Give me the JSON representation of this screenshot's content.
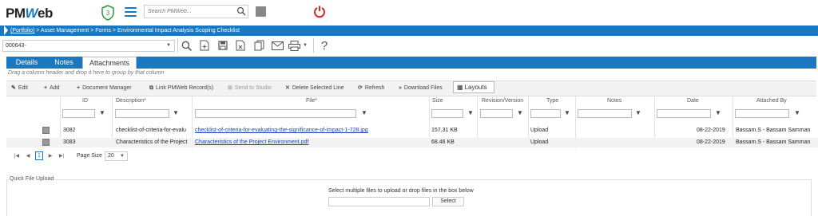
{
  "app": {
    "logo_text": "PMWeb",
    "badge_count": "3",
    "search": {
      "placeholder": "Search PMWeb..."
    }
  },
  "breadcrumb": {
    "root": "(Portfolio)",
    "path": " > Asset Management > Forms > Environmental Impact Analysis Scoping Checklist"
  },
  "record": {
    "selected": "000643-"
  },
  "tabs": [
    {
      "label": "Details"
    },
    {
      "label": "Notes"
    },
    {
      "label": "Attachments",
      "active": true
    }
  ],
  "group_hint": "Drag a column header and drop it here to group by that column",
  "actions": {
    "edit": "Edit",
    "add": "Add",
    "document_manager": "Document Manager",
    "link_records": "Link PMWeb Record(s)",
    "send_to_studio": "Send to Studio",
    "delete_line": "Delete Selected Line",
    "refresh": "Refresh",
    "download": "Download Files",
    "layouts": "Layouts"
  },
  "grid": {
    "columns": [
      "ID",
      "Description*",
      "File*",
      "Size",
      "Revision/Version",
      "Type",
      "Notes",
      "Date",
      "Attached By"
    ],
    "rows": [
      {
        "id": "3082",
        "description": "checklist-of-criteria-for-evalu",
        "file": "checklist-of-criteria-for-evaluating-the-significance-of-impact-1-728.jpg",
        "size": "157.31 KB",
        "revision": "",
        "type": "Upload",
        "notes": "",
        "date": "08-22-2019",
        "attached_by": "Bassam.S - Bassam Samman"
      },
      {
        "id": "3083",
        "description": "Characteristics of the Project",
        "file": "Characteristics of the Project Environment.pdf",
        "size": "68.46 KB",
        "revision": "",
        "type": "Upload",
        "notes": "",
        "date": "08-22-2019",
        "attached_by": "Bassam.S - Bassam Samman"
      }
    ]
  },
  "pager": {
    "current_page": "1",
    "page_size_label": "Page Size",
    "page_size": "20"
  },
  "upload": {
    "legend": "Quick File Upload",
    "instructions": "Select multiple files to upload or drop files in the box below",
    "select_label": "Select"
  },
  "colors": {
    "brand": "#1a78c2",
    "power": "#e02020",
    "link": "#1a3fc2"
  }
}
